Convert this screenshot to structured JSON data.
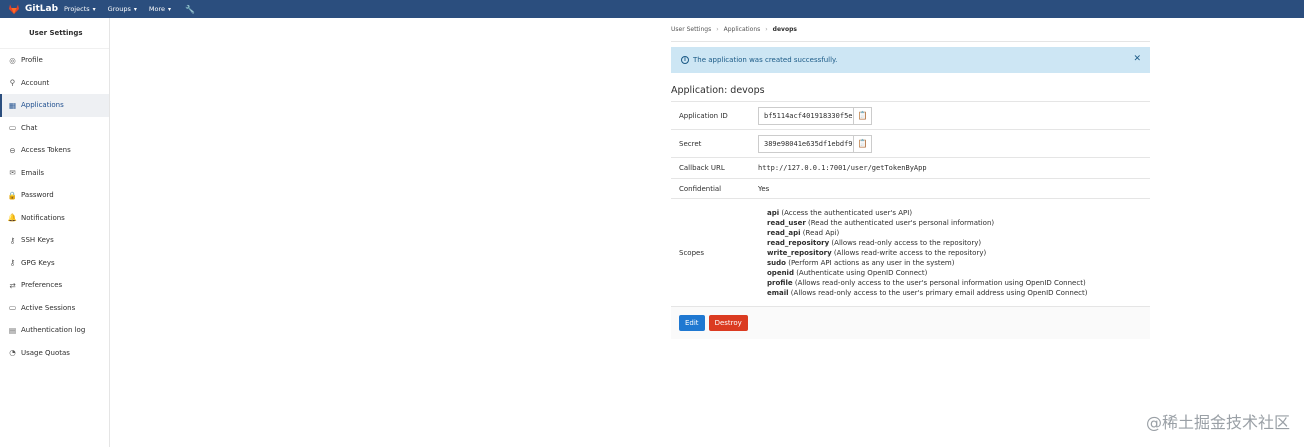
{
  "topbar": {
    "brand": "GitLab",
    "nav": [
      {
        "label": "Projects"
      },
      {
        "label": "Groups"
      },
      {
        "label": "More"
      }
    ]
  },
  "sidebar": {
    "title": "User Settings",
    "items": [
      {
        "label": "Profile",
        "icon": "profile-icon"
      },
      {
        "label": "Account",
        "icon": "account-icon"
      },
      {
        "label": "Applications",
        "icon": "applications-icon",
        "active": true
      },
      {
        "label": "Chat",
        "icon": "chat-icon"
      },
      {
        "label": "Access Tokens",
        "icon": "access-tokens-icon"
      },
      {
        "label": "Emails",
        "icon": "emails-icon"
      },
      {
        "label": "Password",
        "icon": "password-icon"
      },
      {
        "label": "Notifications",
        "icon": "notifications-icon"
      },
      {
        "label": "SSH Keys",
        "icon": "ssh-keys-icon"
      },
      {
        "label": "GPG Keys",
        "icon": "gpg-keys-icon"
      },
      {
        "label": "Preferences",
        "icon": "preferences-icon"
      },
      {
        "label": "Active Sessions",
        "icon": "active-sessions-icon"
      },
      {
        "label": "Authentication log",
        "icon": "authentication-log-icon"
      },
      {
        "label": "Usage Quotas",
        "icon": "usage-quotas-icon"
      }
    ]
  },
  "breadcrumb": {
    "items": [
      "User Settings",
      "Applications",
      "devops"
    ]
  },
  "alert": {
    "message": "The application was created successfully."
  },
  "page": {
    "title": "Application: devops"
  },
  "details": {
    "application_id_label": "Application ID",
    "application_id_value": "bf5114acf401918330f5e",
    "secret_label": "Secret",
    "secret_value": "389e98041e635df1ebdf9",
    "callback_label": "Callback URL",
    "callback_value": "http://127.0.0.1:7001/user/getTokenByApp",
    "confidential_label": "Confidential",
    "confidential_value": "Yes",
    "scopes_label": "Scopes",
    "scopes": [
      {
        "name": "api",
        "desc": " (Access the authenticated user's API)"
      },
      {
        "name": "read_user",
        "desc": " (Read the authenticated user's personal information)"
      },
      {
        "name": "read_api",
        "desc": " (Read Api)"
      },
      {
        "name": "read_repository",
        "desc": " (Allows read-only access to the repository)"
      },
      {
        "name": "write_repository",
        "desc": " (Allows read-write access to the repository)"
      },
      {
        "name": "sudo",
        "desc": " (Perform API actions as any user in the system)"
      },
      {
        "name": "openid",
        "desc": " (Authenticate using OpenID Connect)"
      },
      {
        "name": "profile",
        "desc": " (Allows read-only access to the user's personal information using OpenID Connect)"
      },
      {
        "name": "email",
        "desc": " (Allows read-only access to the user's primary email address using OpenID Connect)"
      }
    ]
  },
  "actions": {
    "edit_label": "Edit",
    "destroy_label": "Destroy"
  },
  "watermark": "@稀土掘金技术社区",
  "colors": {
    "topbar": "#2b4e7e",
    "alert_bg": "#cde6f4",
    "edit": "#1f78d1",
    "destroy": "#db3b21"
  }
}
